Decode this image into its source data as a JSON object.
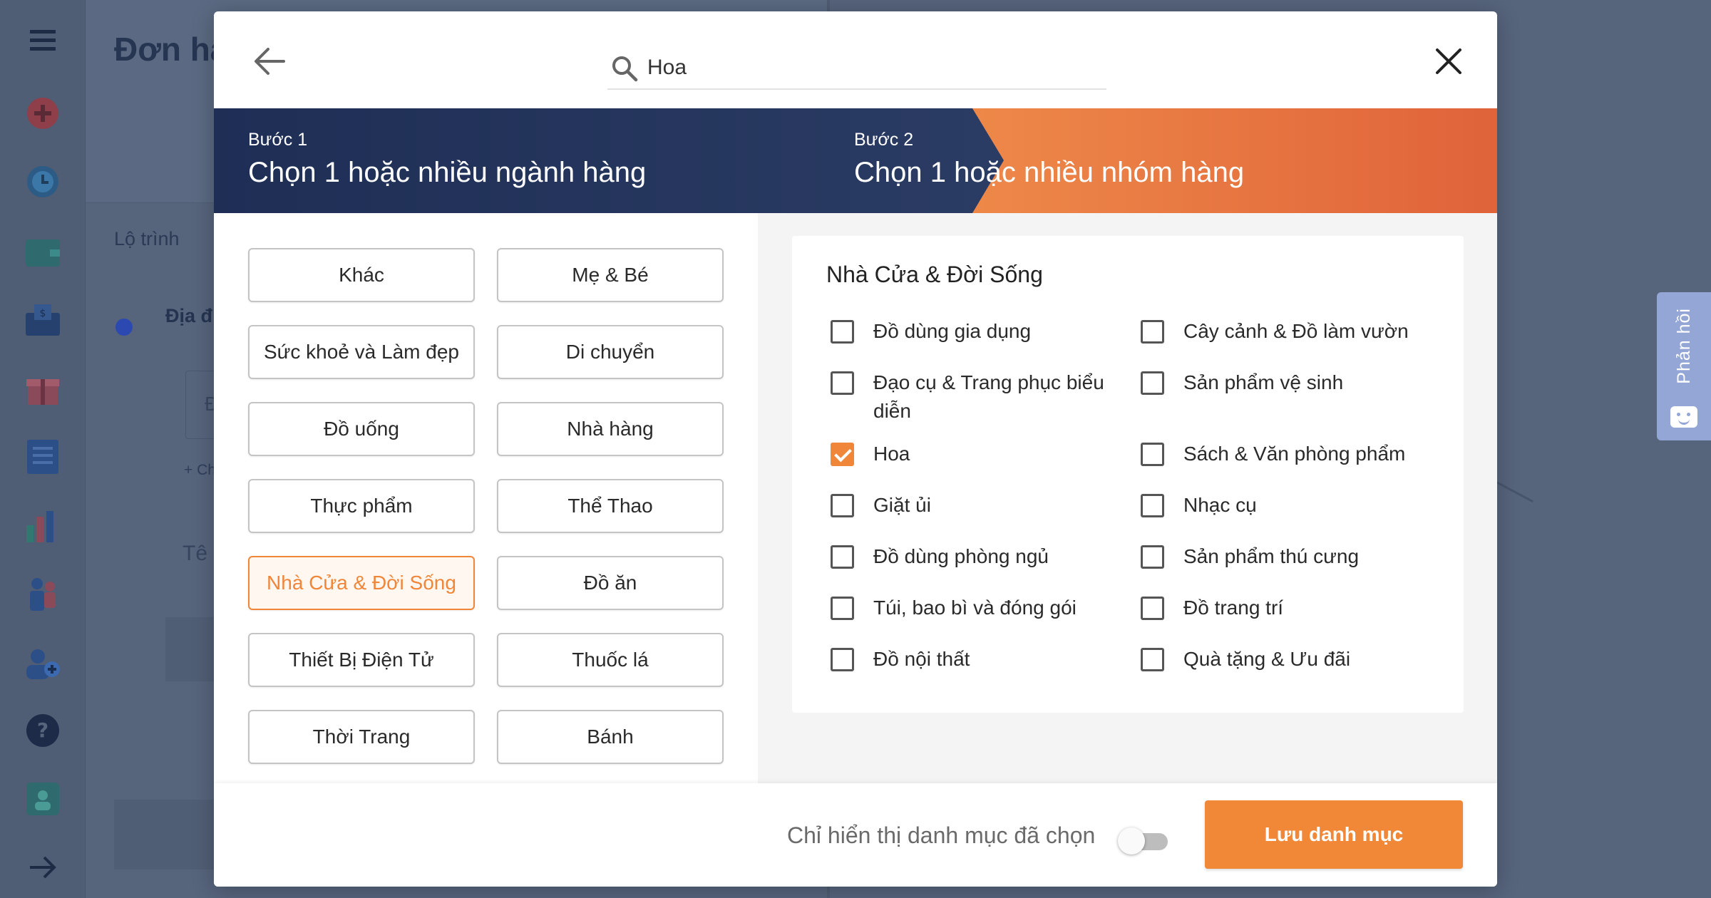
{
  "background": {
    "page_title": "Đơn hà",
    "route_label": "Lộ trình",
    "address_label": "Địa đ",
    "field_hint": "+ Ch",
    "name_label": "Tê",
    "field_letter": "Đ"
  },
  "feedback_tab": {
    "label": "Phản hồi"
  },
  "search": {
    "value": "Hoa",
    "placeholder": ""
  },
  "steps": {
    "step1": {
      "sub": "Bước 1",
      "title": "Chọn 1 hoặc nhiều ngành hàng"
    },
    "step2": {
      "sub": "Bước 2",
      "title": "Chọn 1 hoặc nhiều nhóm hàng"
    }
  },
  "categories": [
    {
      "label": "Khác",
      "active": false
    },
    {
      "label": "Mẹ & Bé",
      "active": false
    },
    {
      "label": "Sức khoẻ và Làm đẹp",
      "active": false
    },
    {
      "label": "Di chuyển",
      "active": false
    },
    {
      "label": "Đồ uống",
      "active": false
    },
    {
      "label": "Nhà hàng",
      "active": false
    },
    {
      "label": "Thực phẩm",
      "active": false
    },
    {
      "label": "Thể Thao",
      "active": false
    },
    {
      "label": "Nhà Cửa & Đời Sống",
      "active": true
    },
    {
      "label": "Đồ ăn",
      "active": false
    },
    {
      "label": "Thiết Bị Điện Tử",
      "active": false
    },
    {
      "label": "Thuốc lá",
      "active": false
    },
    {
      "label": "Thời Trang",
      "active": false
    },
    {
      "label": "Bánh",
      "active": false
    }
  ],
  "group": {
    "title": "Nhà Cửa & Đời Sống",
    "items": [
      {
        "label": "Đồ dùng gia dụng",
        "checked": false
      },
      {
        "label": "Cây cảnh & Đồ làm vườn",
        "checked": false
      },
      {
        "label": "Đạo cụ & Trang phục biểu diễn",
        "checked": false
      },
      {
        "label": "Sản phẩm vệ sinh",
        "checked": false
      },
      {
        "label": "Hoa",
        "checked": true
      },
      {
        "label": "Sách & Văn phòng phẩm",
        "checked": false
      },
      {
        "label": "Giặt ủi",
        "checked": false
      },
      {
        "label": "Nhạc cụ",
        "checked": false
      },
      {
        "label": "Đồ dùng phòng ngủ",
        "checked": false
      },
      {
        "label": "Sản phẩm thú cưng",
        "checked": false
      },
      {
        "label": "Túi, bao bì và đóng gói",
        "checked": false
      },
      {
        "label": "Đồ trang trí",
        "checked": false
      },
      {
        "label": "Đồ nội thất",
        "checked": false
      },
      {
        "label": "Quà tặng & Ưu đãi",
        "checked": false
      }
    ]
  },
  "footer": {
    "show_selected_label": "Chỉ hiển thị danh mục đã chọn",
    "show_selected_on": false,
    "save_label": "Lưu danh mục"
  },
  "colors": {
    "accent": "#f0863a",
    "step1_bg": "#1f2f55",
    "step2_bg": "#ef8c4a",
    "overlay_bg": "#56647c"
  },
  "sidebar_icons": [
    "menu-icon",
    "add-icon",
    "clock-icon",
    "wallet-icon",
    "money-icon",
    "gift-icon",
    "report-icon",
    "chart-icon",
    "people-icon",
    "add-user-icon",
    "help-icon",
    "badge-icon",
    "arrow-right-icon"
  ]
}
